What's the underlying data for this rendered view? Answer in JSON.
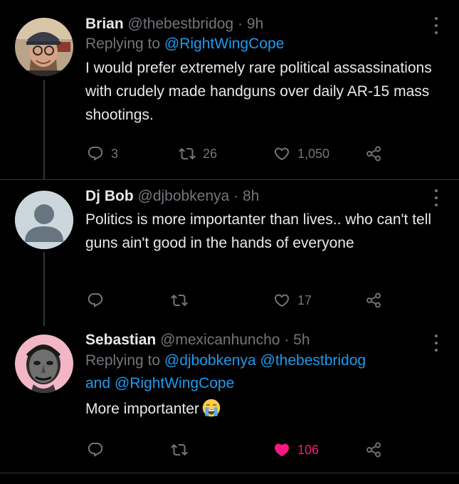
{
  "colors": {
    "background": "#000000",
    "text": "#e7e9ea",
    "muted": "#71767b",
    "link": "#1d9bf0",
    "like": "#f91880"
  },
  "tweets": [
    {
      "name": "Brian",
      "handle": "@thebestbridog",
      "dot": "·",
      "time": "9h",
      "replying_prefix": "Replying to",
      "mentions_line1": [
        "@RightWingCope"
      ],
      "text": "I would prefer extremely rare political assassinations with crudely made handguns over daily AR-15 mass shootings.",
      "replies": "3",
      "retweets": "26",
      "likes": "1,050",
      "liked": false,
      "icons": [
        "reply-icon",
        "retweet-icon",
        "heart-icon",
        "share-icon",
        "more-icon"
      ]
    },
    {
      "name": "Dj Bob",
      "handle": "@djbobkenya",
      "dot": "·",
      "time": "8h",
      "text": "Politics is more importanter than lives.. who can't tell guns ain't good in the hands of everyone",
      "replies": "",
      "retweets": "",
      "likes": "17",
      "liked": false,
      "icons": [
        "reply-icon",
        "retweet-icon",
        "heart-icon",
        "share-icon",
        "more-icon"
      ]
    },
    {
      "name": "Sebastian",
      "handle": "@mexicanhuncho",
      "dot": "·",
      "time": "5h",
      "replying_prefix": "Replying to",
      "mention_a": "@djbobkenya",
      "mention_b": "@thebestbridog",
      "and_word": "and",
      "mention_c": "@RightWingCope",
      "text": "More importanter",
      "emoji": "loudly-crying-face-emoji",
      "replies": "",
      "retweets": "",
      "likes": "106",
      "liked": true,
      "icons": [
        "reply-icon",
        "retweet-icon",
        "heart-filled-icon",
        "share-icon",
        "more-icon"
      ]
    }
  ]
}
